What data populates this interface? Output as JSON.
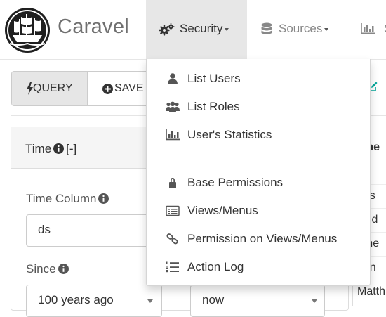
{
  "brand": {
    "name": "Caravel"
  },
  "navbar": {
    "security": {
      "label": "Security"
    },
    "sources": {
      "label": "Sources"
    },
    "slices": {
      "label": "S"
    }
  },
  "toolbar": {
    "query_label": "QUERY",
    "save_label": "SAVE"
  },
  "time_panel": {
    "title": "Time",
    "collapse": "[-]",
    "time_column_label": "Time Column",
    "time_column_value": "ds",
    "since_label": "Since",
    "since_value": "100 years ago",
    "until_value": "now"
  },
  "table": {
    "header": "ame",
    "rows": [
      "ich",
      "hris",
      "avid",
      "ame",
      "ohn",
      "Matth"
    ]
  },
  "security_menu": {
    "items": [
      {
        "label": "List Users",
        "icon": "user-icon"
      },
      {
        "label": "List Roles",
        "icon": "group-icon"
      },
      {
        "label": "User's Statistics",
        "icon": "bar-chart-icon"
      },
      {
        "label": "Base Permissions",
        "icon": "lock-icon"
      },
      {
        "label": "Views/Menus",
        "icon": "list-alt-icon"
      },
      {
        "label": "Permission on Views/Menus",
        "icon": "link-icon"
      },
      {
        "label": "Action Log",
        "icon": "list-ol-icon"
      }
    ]
  },
  "colors": {
    "active_nav_bg": "#e7e7e7",
    "panel_header_bg": "#f5f5f5",
    "brand_text": "#707070",
    "edit_icon": "#00a699"
  }
}
